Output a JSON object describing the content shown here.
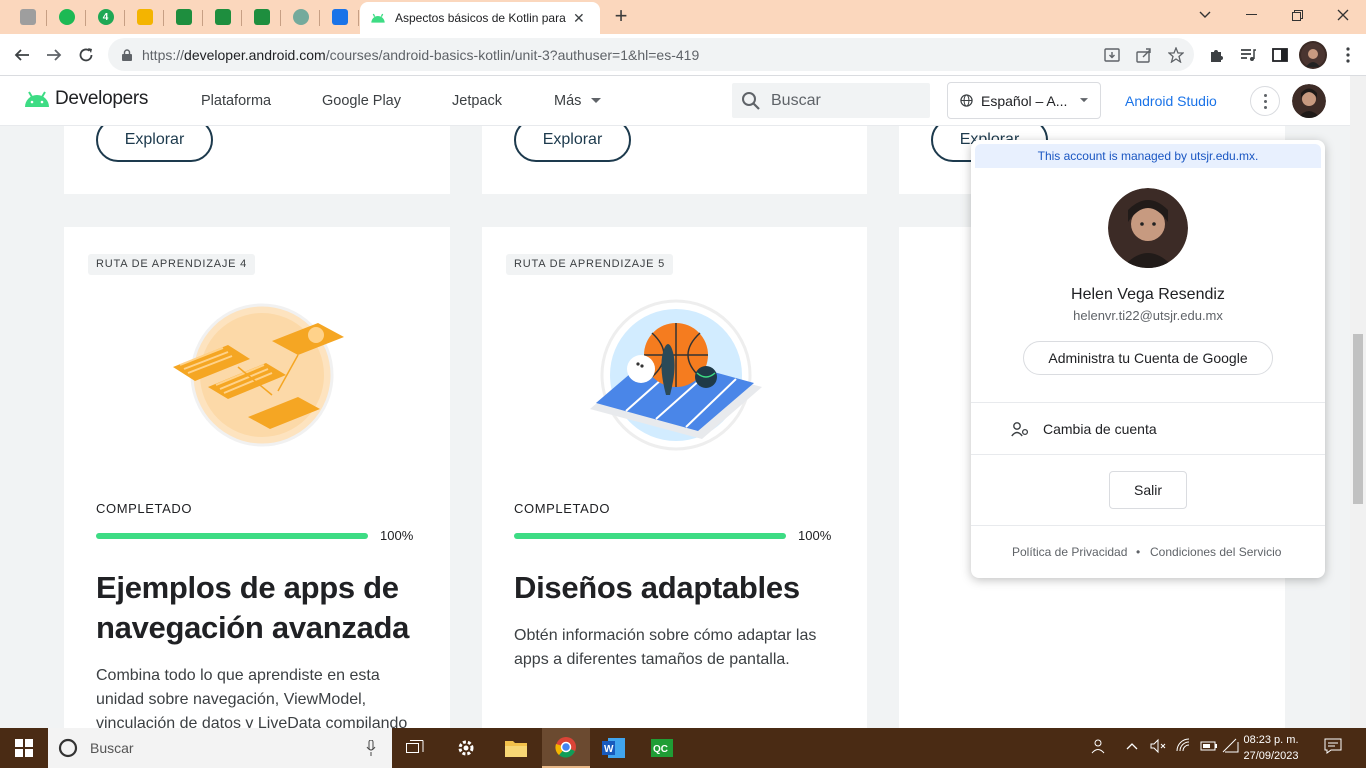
{
  "browser": {
    "active_tab_title": "Aspectos básicos de Kotlin para",
    "pinned_tabs": [
      {
        "icon": "profile-icon",
        "color": "#9e9e9e",
        "glyph": ""
      },
      {
        "icon": "spotify-icon",
        "color": "#1db954",
        "glyph": ""
      },
      {
        "icon": "number-4-icon",
        "color": "#1fa855",
        "glyph": "4"
      },
      {
        "icon": "slides-icon",
        "color": "#f4b400",
        "glyph": ""
      },
      {
        "icon": "classroom-icon",
        "color": "#1e8e3e",
        "glyph": ""
      },
      {
        "icon": "classroom-icon",
        "color": "#1e8e3e",
        "glyph": ""
      },
      {
        "icon": "classroom-icon",
        "color": "#1e8e3e",
        "glyph": ""
      },
      {
        "icon": "chatgpt-icon",
        "color": "#74aa9c",
        "glyph": ""
      },
      {
        "icon": "contacts-icon",
        "color": "#1a73e8",
        "glyph": ""
      }
    ],
    "url_prefix": "https://",
    "url_host": "developer.android.com",
    "url_path": "/courses/android-basics-kotlin/unit-3?authuser=1&hl=es-419"
  },
  "header": {
    "logo_text": "Developers",
    "nav": [
      "Plataforma",
      "Google Play",
      "Jetpack",
      "Más"
    ],
    "search_placeholder": "Buscar",
    "language": "Español – A...",
    "studio_link": "Android Studio"
  },
  "cards_top": {
    "explore_label": "Explorar"
  },
  "cards": [
    {
      "chip": "RUTA DE APRENDIZAJE 4",
      "status": "COMPLETADO",
      "progress": 1.0,
      "percent": "100%",
      "title": "Ejemplos de apps de navegación avanzada",
      "description": "Combina todo lo que aprendiste en esta unidad sobre navegación, ViewModel, vinculación de datos y LiveData compilando"
    },
    {
      "chip": "RUTA DE APRENDIZAJE 5",
      "status": "COMPLETADO",
      "progress": 1.0,
      "percent": "100%",
      "title": "Diseños adaptables",
      "description": "Obtén información sobre cómo adaptar las apps a diferentes tamaños de pantalla."
    }
  ],
  "account": {
    "managed_notice": "This account is managed by utsjr.edu.mx.",
    "name": "Helen Vega Resendiz",
    "email": "helenvr.ti22@utsjr.edu.mx",
    "manage_button": "Administra tu Cuenta de Google",
    "switch_account": "Cambia de cuenta",
    "sign_out": "Salir",
    "privacy": "Política de Privacidad",
    "bullet": "•",
    "terms": "Condiciones del Servicio"
  },
  "taskbar": {
    "search_placeholder": "Buscar",
    "time": "08:23 p. m.",
    "date": "27/09/2023"
  },
  "colors": {
    "tab_strip": "#fbd7bd",
    "android_green": "#3ddc84",
    "link_blue": "#1a73e8",
    "taskbar": "#4a2b14"
  }
}
